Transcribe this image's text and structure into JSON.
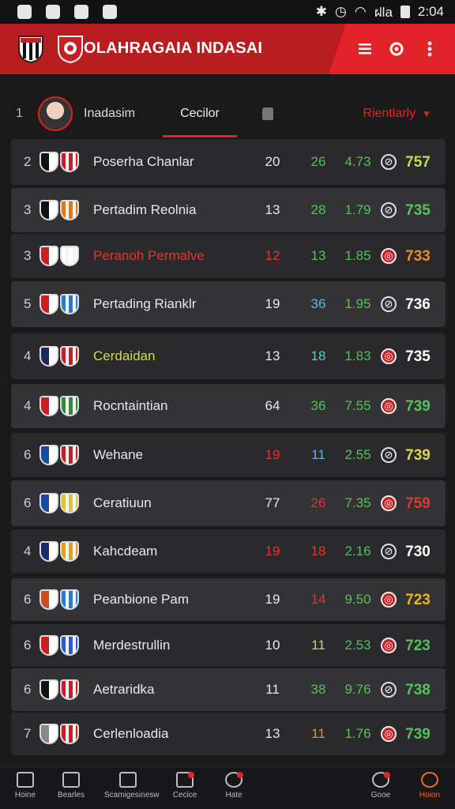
{
  "status_bar": {
    "time": "2:04",
    "network": "ฝla"
  },
  "header": {
    "title": "OLAHRAGAIA INDASAI",
    "brand_color": "#b81d20",
    "accent_color": "#e2232a"
  },
  "subheader": {
    "rank": "1",
    "name": "Inadasim",
    "tab_label": "Cecilor",
    "filter_label": "Rientlarly"
  },
  "table": {
    "rows": [
      {
        "rank": "2",
        "name": "Poserha Chanlar",
        "name_color": "#e8e8e8",
        "played": "20",
        "played_color": "#e8e8e8",
        "wins": "26",
        "wins_color": "#52c25a",
        "ratio": "4.73",
        "icon": "globe-icon",
        "points": "757",
        "points_color": "#b6e04a"
      },
      {
        "rank": "3",
        "name": "Pertadim Reolnia",
        "name_color": "#e8e8e8",
        "played": "13",
        "played_color": "#e8e8e8",
        "wins": "28",
        "wins_color": "#52c25a",
        "ratio": "1.79",
        "icon": "globe-icon",
        "points": "735",
        "points_color": "#52c25a"
      },
      {
        "rank": "3",
        "name": "Peranoh Permalve",
        "name_color": "#e2372e",
        "played": "12",
        "played_color": "#e2372e",
        "wins": "13",
        "wins_color": "#52c25a",
        "ratio": "1.85",
        "icon": "ball-icon",
        "points": "733",
        "points_color": "#f08a24"
      },
      {
        "rank": "5",
        "name": "Pertading Rianklr",
        "name_color": "#e8e8e8",
        "played": "19",
        "played_color": "#e8e8e8",
        "wins": "36",
        "wins_color": "#5bb6e6",
        "ratio": "1.95",
        "icon": "globe-icon",
        "points": "736",
        "points_color": "#ffffff"
      },
      {
        "rank": "4",
        "name": "Cerdaidan",
        "name_color": "#d8d84a",
        "played": "13",
        "played_color": "#e8e8e8",
        "wins": "18",
        "wins_color": "#5bc8c8",
        "ratio": "1.83",
        "icon": "ball-icon",
        "points": "735",
        "points_color": "#ffffff"
      },
      {
        "rank": "4",
        "name": "Rocntaintian",
        "name_color": "#e8e8e8",
        "played": "64",
        "played_color": "#e8e8e8",
        "wins": "36",
        "wins_color": "#52c25a",
        "ratio": "7.55",
        "icon": "ball-icon",
        "points": "739",
        "points_color": "#52c25a"
      },
      {
        "rank": "6",
        "name": "Wehane",
        "name_color": "#e8e8e8",
        "played": "19",
        "played_color": "#e2372e",
        "wins": "11",
        "wins_color": "#5bb6e6",
        "ratio": "2.55",
        "icon": "globe-icon",
        "points": "739",
        "points_color": "#d8d84a"
      },
      {
        "rank": "6",
        "name": "Ceratiuun",
        "name_color": "#e8e8e8",
        "played": "77",
        "played_color": "#e8e8e8",
        "wins": "26",
        "wins_color": "#e2372e",
        "ratio": "7.35",
        "icon": "ball-icon",
        "points": "759",
        "points_color": "#e2372e"
      },
      {
        "rank": "4",
        "name": "Kahcdeam",
        "name_color": "#e8e8e8",
        "played": "19",
        "played_color": "#e2372e",
        "wins": "18",
        "wins_color": "#e2372e",
        "ratio": "2.16",
        "icon": "globe-icon",
        "points": "730",
        "points_color": "#ffffff"
      },
      {
        "rank": "6",
        "name": "Peanbione Pam",
        "name_color": "#e8e8e8",
        "played": "19",
        "played_color": "#e8e8e8",
        "wins": "14",
        "wins_color": "#e2372e",
        "ratio": "9.50",
        "icon": "ball-icon",
        "points": "723",
        "points_color": "#f0b020"
      },
      {
        "rank": "6",
        "name": "Merdestrullin",
        "name_color": "#e8e8e8",
        "played": "10",
        "played_color": "#e8e8e8",
        "wins": "11",
        "wins_color": "#b6e04a",
        "ratio": "2.53",
        "icon": "ball-icon",
        "points": "723",
        "points_color": "#52c25a"
      },
      {
        "rank": "6",
        "name": "Aetraridka",
        "name_color": "#e8e8e8",
        "played": "11",
        "played_color": "#e8e8e8",
        "wins": "38",
        "wins_color": "#52c25a",
        "ratio": "9.76",
        "icon": "globe-icon",
        "points": "738",
        "points_color": "#52c25a"
      },
      {
        "rank": "7",
        "name": "Cerlenloadia",
        "name_color": "#e8e8e8",
        "played": "13",
        "played_color": "#e8e8e8",
        "wins": "11",
        "wins_color": "#f08a24",
        "ratio": "1.76",
        "icon": "ball-icon",
        "points": "739",
        "points_color": "#52c25a"
      }
    ]
  },
  "bottom_nav": [
    {
      "label": "Hoine",
      "icon": "home-icon"
    },
    {
      "label": "Bearles",
      "icon": "table-icon"
    },
    {
      "label": "Scamigesinesw",
      "icon": "edit-icon"
    },
    {
      "label": "Cecice",
      "icon": "people-icon",
      "badge": true
    },
    {
      "label": "Hate",
      "icon": "ball-icon",
      "badge": true
    },
    {
      "label": "Gooe",
      "icon": "heart-icon",
      "badge": true
    },
    {
      "label": "Hoion",
      "icon": "search-icon",
      "active": true
    }
  ]
}
